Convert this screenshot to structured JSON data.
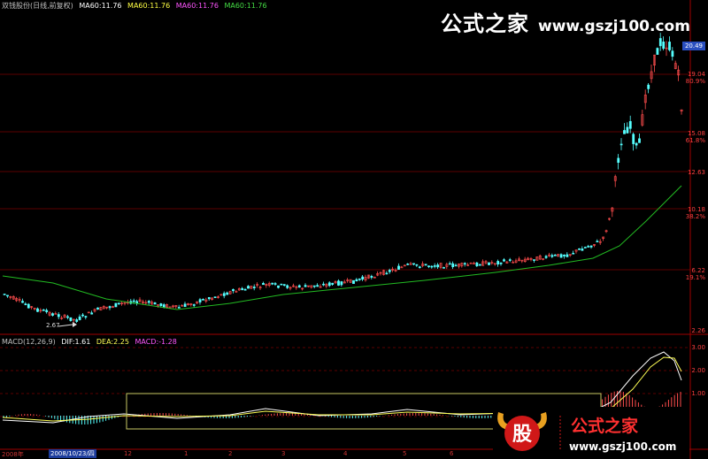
{
  "header": {
    "title": "双钱股份(日线,前复权)",
    "ma1": "MA60:11.76",
    "ma2": "MA60:11.76",
    "ma3": "MA60:11.76",
    "ma4": "MA60:11.76"
  },
  "brand": {
    "name": "公式之家",
    "url": "www.gszj100.com",
    "badge": "股",
    "bottom_url": "www.gszj100.com"
  },
  "price_axis": {
    "labels": [
      "19.04",
      "80.9%",
      "15.08",
      "61.8%",
      "12.63",
      "10.18",
      "38.2%",
      "6.22",
      "19.1%",
      "2.26"
    ],
    "high_label": "20.49"
  },
  "annotations": {
    "low_price": "2.67"
  },
  "macd": {
    "title": "MACD(12,26,9)",
    "dif": "DIF:1.61",
    "dea": "DEA:2.25",
    "macd": "MACD:-1.28",
    "axis_labels": [
      "3.00",
      "2.00",
      "1.00"
    ]
  },
  "time_axis": {
    "year": "2008年",
    "current_date": "2008/10/23/四",
    "ticks": [
      "12",
      "1",
      "2",
      "3",
      "4",
      "5",
      "6"
    ]
  },
  "colors": {
    "up": "#ff4d4d",
    "down": "#55ffff",
    "ma": "#22bb22",
    "grid": "#7a0000",
    "axis": "#a00000",
    "selection_box": "#c8c864",
    "dif": "#ffffff",
    "dea": "#ffff55",
    "macd_label": "#ff55ff",
    "title": "#c0c0c0",
    "ma_label": "#ffff44"
  }
}
